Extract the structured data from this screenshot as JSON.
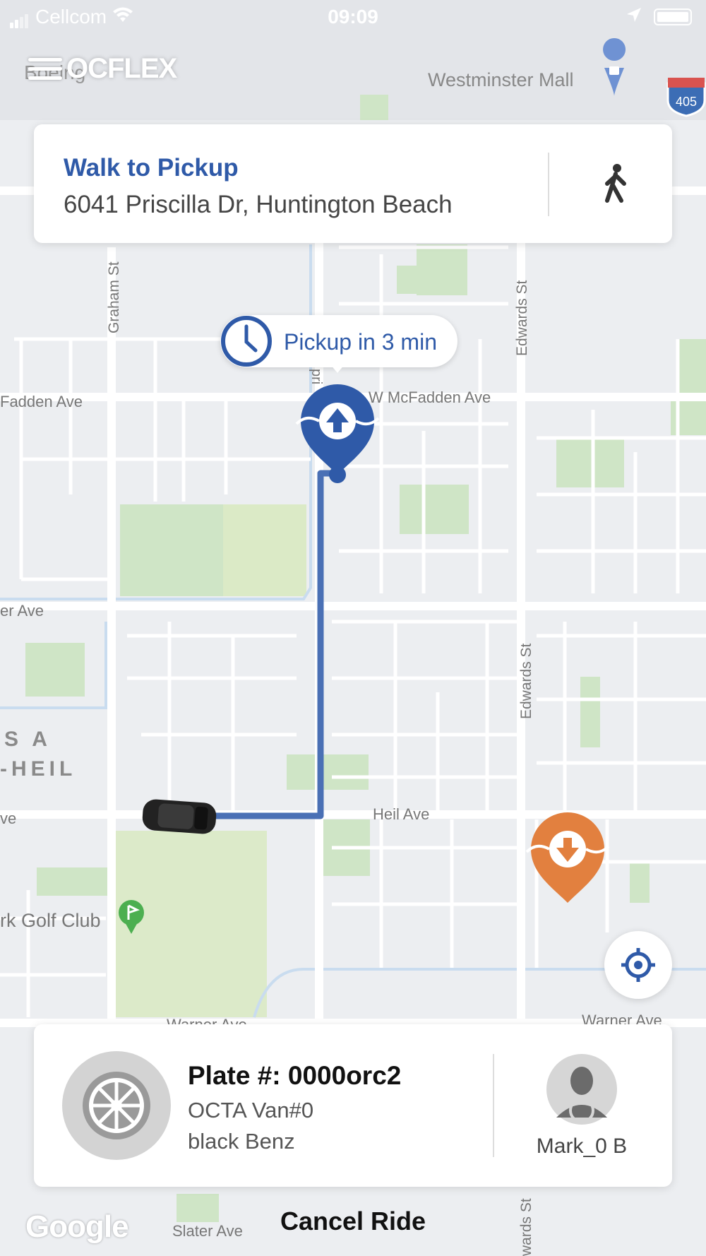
{
  "status_bar": {
    "carrier": "Cellcom",
    "time": "09:09"
  },
  "app": {
    "logo": "OCFLEX"
  },
  "walk_card": {
    "title": "Walk to Pickup",
    "address": "6041 Priscilla Dr, Huntington Beach",
    "icon": "walking-person-icon"
  },
  "pickup": {
    "eta": "Pickup in 3 min",
    "icon": "clock-icon"
  },
  "map": {
    "labels": {
      "westminster_mall": "Westminster Mall",
      "boeing": "Boeing",
      "highway": "405",
      "graham_st": "Graham St",
      "edwards_st_upper": "Edwards St",
      "edwards_st_lower": "Edwards St",
      "edwards_st_bottom": "wards St",
      "mcfadden_left": "Fadden Ave",
      "mcfadden_right": "W McFadden Ave",
      "priscilla": "pri",
      "ave_left": "er Ave",
      "sa": "S A",
      "heil_area": "-HEIL",
      "ve": "ve",
      "heil_ave": "Heil Ave",
      "golf": "rk Golf Club",
      "warner_left": "Warner Ave",
      "warner_right": "Warner Ave",
      "slater": "Slater Ave"
    },
    "route_color": "#4a70b5",
    "pickup_pin_color": "#2f5aa8",
    "dropoff_pin_color": "#e2803f",
    "park_color": "#cfe5c6"
  },
  "driver": {
    "plate": "Plate #: 0000orc2",
    "vehicle": "OCTA Van#0",
    "color": "black Benz",
    "name": "Mark_0 B"
  },
  "actions": {
    "cancel": "Cancel Ride"
  },
  "attribution": {
    "google": "Google"
  }
}
